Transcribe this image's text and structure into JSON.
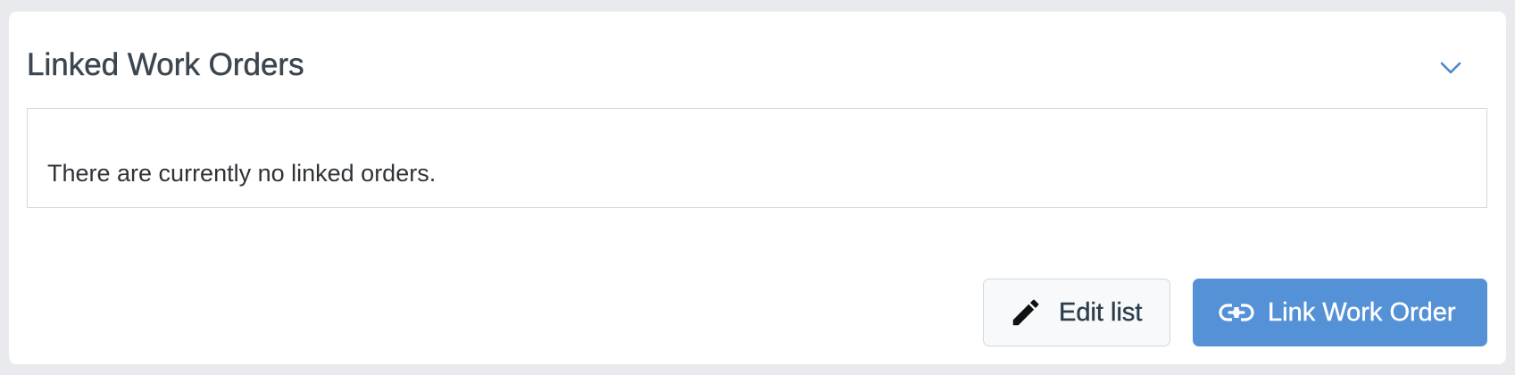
{
  "panel": {
    "title": "Linked Work Orders",
    "collapse_icon": "chevron-down-icon",
    "empty_message": "There are currently no linked orders."
  },
  "actions": {
    "edit_label": "Edit list",
    "edit_icon": "pencil-icon",
    "link_label": "Link Work Order",
    "link_icon": "link-icon"
  },
  "colors": {
    "accent": "#5591d6",
    "chevron": "#4a86c8",
    "page_background": "#e8eaed",
    "card_background": "#ffffff",
    "title_text": "#3c4650"
  }
}
